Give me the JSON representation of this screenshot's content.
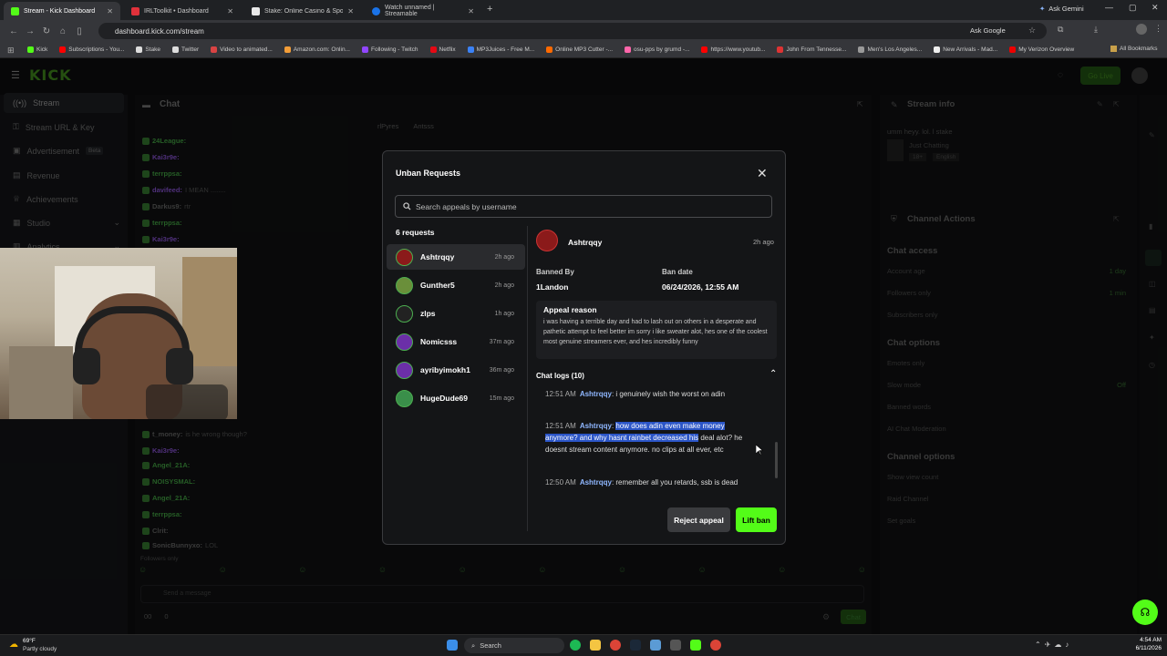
{
  "browser": {
    "tabs": [
      {
        "title": "Stream - Kick Dashboard",
        "color": "#53fc18",
        "active": true
      },
      {
        "title": "IRLToolkit • Dashboard",
        "color": "#e0313b",
        "active": false
      },
      {
        "title": "Stake: Online Casino & Sports",
        "color": "#e8e8e8",
        "active": false
      },
      {
        "title": "Watch unnamed | Streamable",
        "color": "#1a73e8",
        "active": false
      }
    ],
    "ask_gemini": "Ask Gemini",
    "url": "dashboard.kick.com/stream",
    "ask_google": "Ask Google",
    "bookmarks": [
      {
        "label": "Kick",
        "color": "#53fc18"
      },
      {
        "label": "Subscriptions - You...",
        "color": "#ff0000"
      },
      {
        "label": "Stake",
        "color": "#ddd"
      },
      {
        "label": "Twitter",
        "color": "#ddd"
      },
      {
        "label": "Video to animated...",
        "color": "#d94343"
      },
      {
        "label": "Amazon.com: Onlin...",
        "color": "#f29d38"
      },
      {
        "label": "Following - Twitch",
        "color": "#9146ff"
      },
      {
        "label": "Netflix",
        "color": "#e50914"
      },
      {
        "label": "MP3Juices - Free M...",
        "color": "#3b82f6"
      },
      {
        "label": "Online MP3 Cutter -...",
        "color": "#ff6a00"
      },
      {
        "label": "osu-pps by grumd -...",
        "color": "#ff66aa"
      },
      {
        "label": "https://www.youtub...",
        "color": "#ff0000"
      },
      {
        "label": "John From Tennesse...",
        "color": "#d33"
      },
      {
        "label": "Men's Los Angeles...",
        "color": "#999"
      },
      {
        "label": "New Arrivals - Mad...",
        "color": "#eee"
      },
      {
        "label": "My Verizon Overview",
        "color": "#e00"
      }
    ],
    "all_bookmarks": "All Bookmarks"
  },
  "kick": {
    "logo": "KICK",
    "go_live": "Go Live",
    "sidebar": [
      {
        "label": "Stream",
        "active": true
      },
      {
        "label": "Stream URL & Key"
      },
      {
        "label": "Advertisement",
        "badge": "Beta"
      },
      {
        "label": "Revenue"
      },
      {
        "label": "Achievements"
      },
      {
        "label": "Studio"
      },
      {
        "label": "Analytics"
      }
    ],
    "chat": {
      "title": "Chat",
      "top_users": [
        "rlPyres",
        "Antsss"
      ],
      "lines": [
        {
          "user": "24League:",
          "msg": "",
          "color": "#3b8f3b"
        },
        {
          "user": "Kai3r9e:",
          "msg": "",
          "color": "#7b4bbf"
        },
        {
          "user": "terrppsa:",
          "msg": "",
          "color": "#3b8f3b"
        },
        {
          "user": "davifeed:",
          "msg": "I MEAN ........",
          "color": "#7b4bbf"
        },
        {
          "user": "Darkus9:",
          "msg": "rtr",
          "color": "#5a5a5a"
        },
        {
          "user": "terrppsa:",
          "msg": "",
          "color": "#3b8f3b"
        },
        {
          "user": "Kai3r9e:",
          "msg": "",
          "color": "#7b4bbf"
        },
        {
          "user": "t_money:",
          "msg": "is he wrong though?",
          "color": "#5a5a5a"
        },
        {
          "user": "Kai3r9e:",
          "msg": "",
          "color": "#7b4bbf"
        },
        {
          "user": "Angel_21A:",
          "msg": "",
          "color": "#3b8f3b"
        },
        {
          "user": "NOISYSMAL:",
          "msg": "",
          "color": "#3b8f3b"
        },
        {
          "user": "Angel_21A:",
          "msg": "",
          "color": "#3b8f3b"
        },
        {
          "user": "terrppsa:",
          "msg": "",
          "color": "#3b8f3b"
        },
        {
          "user": "Clrit:",
          "msg": "",
          "color": "#5a5a5a"
        },
        {
          "user": "SonicBunnyxo:",
          "msg": "LOL",
          "color": "#5a5a5a"
        }
      ],
      "followers_only": "Followers only",
      "send_placeholder": "Send a message",
      "chat_button": "Chat",
      "counts": [
        "00",
        "0"
      ]
    },
    "stream_info": {
      "title": "Stream info",
      "stream_title": "umm heyy. lol. l stake",
      "category": "Just Chatting",
      "tags": [
        "18+",
        "English"
      ]
    },
    "channel_actions": {
      "title": "Channel Actions",
      "sections": [
        {
          "heading": "Chat access",
          "rows": [
            {
              "label": "Account age",
              "value": "1 day"
            },
            {
              "label": "Followers only",
              "value": "1 min"
            },
            {
              "label": "Subscribers only",
              "value": ""
            }
          ]
        },
        {
          "heading": "Chat options",
          "rows": [
            {
              "label": "Emotes only",
              "value": ""
            },
            {
              "label": "Slow mode",
              "value": "Off"
            },
            {
              "label": "Banned words",
              "value": ""
            },
            {
              "label": "AI Chat Moderation",
              "value": ""
            }
          ]
        },
        {
          "heading": "Channel options",
          "rows": [
            {
              "label": "Show view count",
              "value": ""
            },
            {
              "label": "Raid Channel",
              "value": ""
            },
            {
              "label": "Set goals",
              "value": ""
            }
          ]
        }
      ]
    }
  },
  "modal": {
    "title": "Unban Requests",
    "search_placeholder": "Search appeals by username",
    "requests_count": "6 requests",
    "requests": [
      {
        "name": "Ashtrqqy",
        "time": "2h ago",
        "color": "#8b1a1a",
        "selected": true
      },
      {
        "name": "Gunther5",
        "time": "2h ago",
        "color": "#6a8f3a"
      },
      {
        "name": "zlps",
        "time": "1h ago",
        "color": "#222"
      },
      {
        "name": "Nomicsss",
        "time": "37m ago",
        "color": "#6b2fa8"
      },
      {
        "name": "ayribyimokh1",
        "time": "36m ago",
        "color": "#6b2fa8"
      },
      {
        "name": "HugeDude69",
        "time": "15m ago",
        "color": "#3a8f4a"
      }
    ],
    "detail": {
      "username": "Ashtrqqy",
      "time": "2h ago",
      "banned_by_label": "Banned By",
      "banned_by": "1Landon",
      "ban_date_label": "Ban date",
      "ban_date": "06/24/2026, 12:55 AM",
      "appeal_heading": "Appeal reason",
      "appeal_text": "i was having a terrible day and had to lash out on others in a desperate and pathetic attempt to feel better im sorry i like sweater alot, hes one of the coolest most genuine streamers ever, and hes incredibly funny",
      "chat_logs_label": "Chat logs (10)",
      "logs": [
        {
          "time": "12:51 AM",
          "user": "Ashtrqqy",
          "msg": "i genuinely wish the worst on adin",
          "highlight": ""
        },
        {
          "time": "12:51 AM",
          "user": "Ashtrqqy",
          "highlight": "how does adin even make money anymore? and why hasnt rainbet decreased his",
          "msg": " deal alot? he doesnt stream content anymore. no clips at all ever, etc"
        },
        {
          "time": "12:50 AM",
          "user": "Ashtrqqy",
          "msg": "remember all you retards, ssb is dead",
          "highlight": ""
        }
      ],
      "reject_label": "Reject appeal",
      "lift_label": "Lift ban"
    }
  },
  "taskbar": {
    "weather_temp": "69°F",
    "weather_desc": "Partly cloudy",
    "search": "Search",
    "time": "4:54 AM",
    "date": "6/11/2026"
  }
}
